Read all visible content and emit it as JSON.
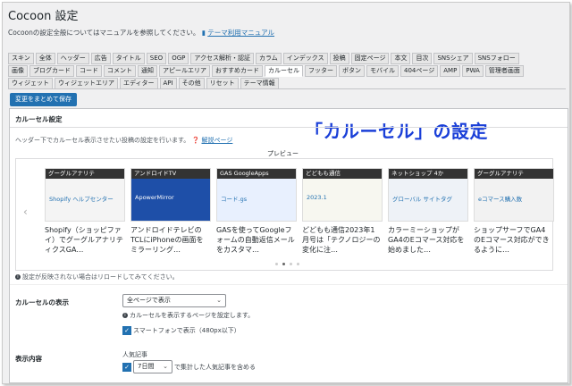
{
  "page": {
    "title": "Cocoon 設定",
    "description": "Cocoonの設定全般についてはマニュアルを参照してください。",
    "manual_link": "テーマ利用マニュアル"
  },
  "tabs_row1": [
    "スキン",
    "全体",
    "ヘッダー",
    "広告",
    "タイトル",
    "SEO",
    "OGP",
    "アクセス解析・認証",
    "カラム",
    "インデックス",
    "投稿",
    "固定ページ",
    "本文",
    "目次",
    "SNSシェア",
    "SNSフォロー"
  ],
  "tabs_row2": [
    "画像",
    "ブログカード",
    "コード",
    "コメント",
    "通知",
    "アピールエリア",
    "おすすめカード",
    "カルーセル",
    "フッター",
    "ボタン",
    "モバイル",
    "404ページ",
    "AMP",
    "PWA",
    "管理者画面"
  ],
  "tabs_row3": [
    "ウィジェット",
    "ウィジェットエリア",
    "エディター",
    "API",
    "その他",
    "リセット",
    "テーマ情報"
  ],
  "active_tab": "カルーセル",
  "save_button": "変更をまとめて保存",
  "panel": {
    "title": "カルーセル設定",
    "description": "ヘッダー下でカルーセル表示させたい投稿の設定を行います。",
    "help_link": "解説ページ",
    "overlay_caption": "「カルーセル」の設定",
    "preview_label": "プレビュー",
    "reload_note": "設定が反映されない場合はリロードしてみてください。"
  },
  "carousel": {
    "prev_arrow": "‹",
    "next_arrow": "›",
    "cards": [
      {
        "title": "Shopify（ショッピファイ）でグーグルアナリティクスGA…",
        "thumb_text": "グーグルアナリテ",
        "thumb_sub": "Shopify ヘルプセンター",
        "bg": "#f4f4f4"
      },
      {
        "title": "アンドロイドテレビのTCLにiPhoneの画面をミラーリング…",
        "thumb_text": "アンドロイドTV",
        "thumb_sub": "ApowerMirror",
        "bg": "#1e4fa8"
      },
      {
        "title": "GASを使ってGoogleフォームの自動返信メールをカスタマ…",
        "thumb_text": "GAS GoogleApps",
        "thumb_sub": "コード.gs",
        "bg": "#e8f0fe"
      },
      {
        "title": "どどもも通信2023年1月号は「テクノロジーの変化に注…",
        "thumb_text": "どどもも通信",
        "thumb_sub": "2023.1",
        "bg": "#f7f7f0"
      },
      {
        "title": "カラーミーショップがGA4のEコマース対応を始めました…",
        "thumb_text": "ネットショップ 4か",
        "thumb_sub": "グローバル サイトタグ",
        "bg": "#eef2f7"
      },
      {
        "title": "ショップサーフでGA4のEコマース対応ができるように…",
        "thumb_text": "グーグルアナリテ",
        "thumb_sub": "eコマース購入数",
        "bg": "#f2f2f2"
      }
    ],
    "dot_count": 4,
    "active_dot": 1
  },
  "settings": {
    "display_label": "カルーセルの表示",
    "display_value": "全ページで表示",
    "display_note": "カルーセルを表示するページを設定します。",
    "smartphone_label": "スマートフォンで表示（480px以下）",
    "content_label": "表示内容",
    "popular_label": "人気記事",
    "period_value": "7日間",
    "period_note": "で集計した人気記事を含める"
  },
  "colors": {
    "accent": "#2271b1",
    "overlay": "#1a3fd8"
  },
  "icons": {
    "info": "info-icon",
    "help": "help-icon",
    "check": "check-icon",
    "chevron": "chevron-down-icon"
  }
}
